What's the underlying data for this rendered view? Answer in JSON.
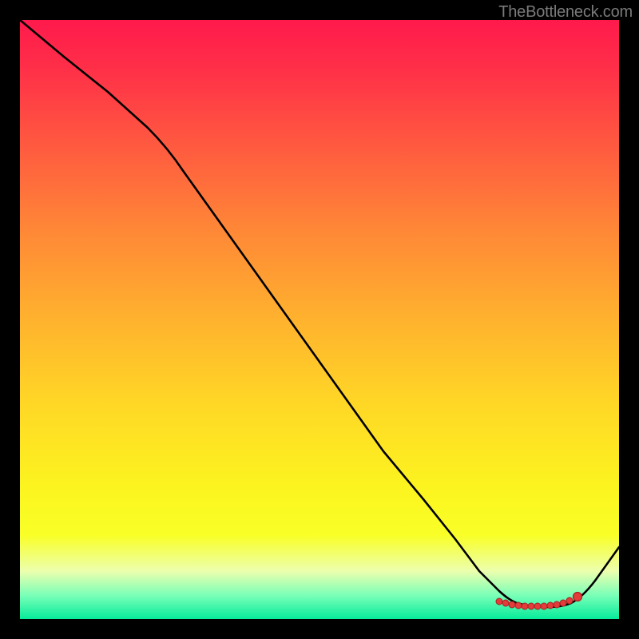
{
  "watermark": "TheBottleneck.com",
  "colors": {
    "background": "#000000",
    "curve": "#000000",
    "dot_fill": "#e43b3b",
    "dot_stroke": "#a82222",
    "gradient_top": "#ff1a4c",
    "gradient_bottom": "#06ec9b"
  },
  "chart_data": {
    "type": "line",
    "title": "",
    "xlabel": "",
    "ylabel": "",
    "xlim": [
      0,
      100
    ],
    "ylim": [
      0,
      100
    ],
    "grid": false,
    "legend": false,
    "notes": "Unlabeled gradient chart; values below are approximate y-readings (0=bottom, 100=top) against a 0–100 x domain, traced from the black curve.",
    "series": [
      {
        "name": "curve",
        "x": [
          0,
          5,
          10,
          15,
          20,
          25,
          30,
          35,
          40,
          45,
          50,
          55,
          60,
          65,
          70,
          75,
          80,
          82,
          84,
          86,
          88,
          90,
          92,
          100
        ],
        "values": [
          100,
          96,
          92,
          88,
          83,
          78,
          70,
          62,
          54,
          46,
          38,
          30,
          22,
          15,
          10,
          6,
          3,
          2.5,
          2.3,
          2.2,
          2.2,
          2.5,
          4,
          12
        ]
      }
    ],
    "marker_cluster": {
      "description": "Tight cluster of red markers along the curve's bottom trough",
      "x": [
        80,
        81,
        82,
        83,
        84,
        85,
        86,
        87,
        88,
        89,
        90,
        91,
        92
      ],
      "values": [
        3.0,
        2.8,
        2.6,
        2.5,
        2.4,
        2.3,
        2.2,
        2.2,
        2.2,
        2.3,
        2.5,
        3.0,
        4.0
      ]
    }
  }
}
